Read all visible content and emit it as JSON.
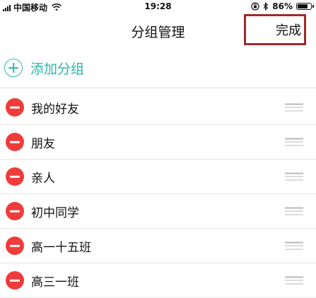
{
  "status_bar": {
    "carrier": "中国移动",
    "time": "19:28",
    "battery_percent_label": "86%",
    "battery_level": 0.86
  },
  "nav": {
    "title": "分组管理",
    "done_label": "完成",
    "highlight_color": "#a0282a"
  },
  "add_group": {
    "label": "添加分组",
    "icon": "plus-circle-icon",
    "accent_color": "#2bb8a8"
  },
  "groups": [
    {
      "name": "我的好友"
    },
    {
      "name": "朋友"
    },
    {
      "name": "亲人"
    },
    {
      "name": "初中同学"
    },
    {
      "name": "高一十五班"
    },
    {
      "name": "高三一班"
    }
  ],
  "row_icons": {
    "delete": "minus-circle-icon",
    "reorder": "drag-handle-icon",
    "delete_color": "#f03b3b"
  }
}
